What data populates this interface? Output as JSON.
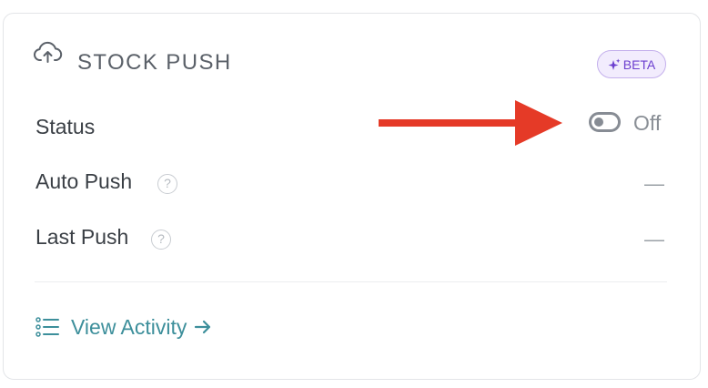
{
  "header": {
    "title": "STOCK PUSH",
    "icon": "cloud-upload-icon",
    "badge": {
      "label": "BETA",
      "icon": "sparkles-icon",
      "color": "#6c3fcf",
      "background": "#f2ecfd"
    }
  },
  "rows": [
    {
      "label": "Status",
      "value": "Off",
      "control": "toggle",
      "toggle_on": false
    },
    {
      "label": "Auto Push",
      "value": "—",
      "help_icon": "help-circle-icon"
    },
    {
      "label": "Last Push",
      "value": "—",
      "help_icon": "help-circle-icon"
    }
  ],
  "footer": {
    "link_label": "View Activity",
    "link_icon": "list-icon",
    "arrow": "→",
    "link_color": "#3d8f9b"
  },
  "annotation": {
    "type": "arrow",
    "color": "#e53a27"
  }
}
